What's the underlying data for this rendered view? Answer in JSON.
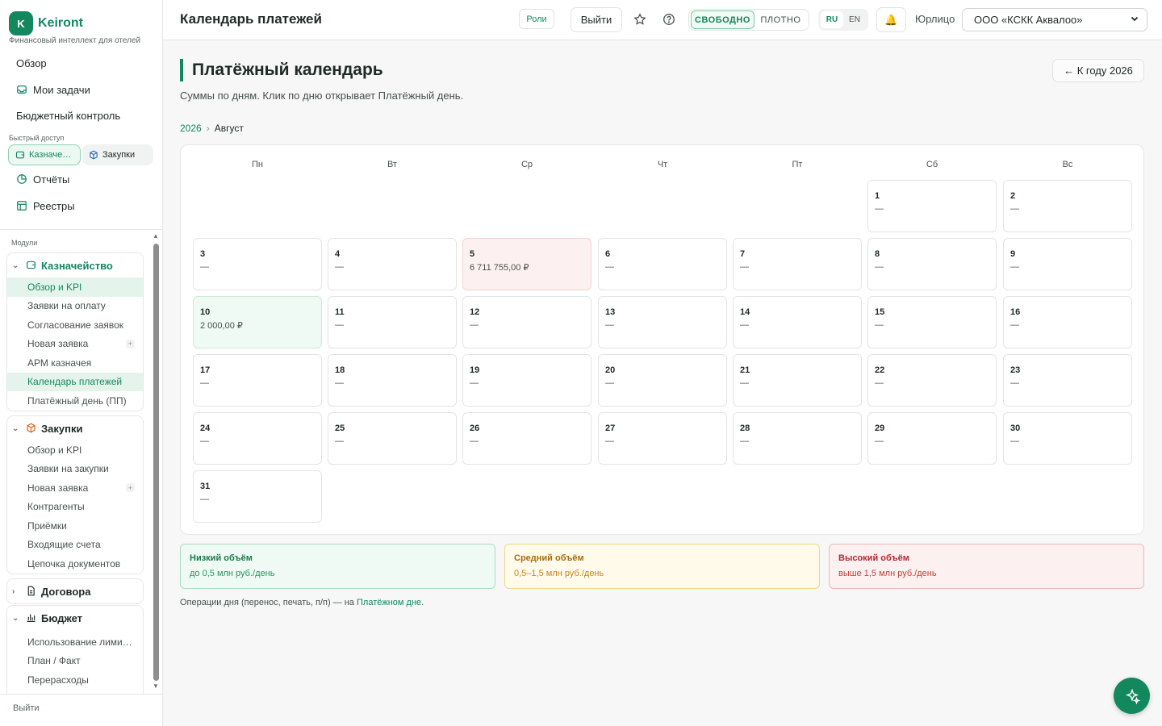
{
  "brand": {
    "logo_letter": "K",
    "name": "Keiront",
    "tagline": "Финансовый интеллект для отелей"
  },
  "sidebar": {
    "top_items": [
      {
        "label": "Обзор"
      },
      {
        "label": "Мои задачи"
      },
      {
        "label": "Бюджетный контроль"
      }
    ],
    "quick_access_label": "Быстрый доступ",
    "quick_chips": [
      {
        "label": "Казначе…"
      },
      {
        "label": "Закупки"
      }
    ],
    "extra_items": [
      {
        "label": "Отчёты"
      },
      {
        "label": "Реестры"
      }
    ],
    "modules_label": "Модули",
    "modules": [
      {
        "title": "Казначейство",
        "items": [
          "Обзор и KPI",
          "Заявки на оплату",
          "Согласование заявок",
          "Новая заявка",
          "АРМ казначея",
          "Календарь платежей",
          "Платёжный день (ПП)"
        ]
      },
      {
        "title": "Закупки",
        "items": [
          "Обзор и KPI",
          "Заявки на закупки",
          "Новая заявка",
          "Контрагенты",
          "Приёмки",
          "Входящие счета",
          "Цепочка документов"
        ]
      },
      {
        "title": "Договора",
        "items": []
      },
      {
        "title": "Бюджет",
        "items": [
          "Использование лими…",
          "План / Факт",
          "Перерасходы"
        ]
      }
    ],
    "plus_sign": "+",
    "logout_label": "Выйти"
  },
  "header": {
    "title": "Календарь платежей",
    "roles_label": "Роли",
    "exit_label": "Выйти",
    "density_options": [
      "СВОБОДНО",
      "ПЛОТНО"
    ],
    "density_selected": "СВОБОДНО",
    "languages": [
      "RU",
      "EN"
    ],
    "language_selected": "RU",
    "entity_label": "Юрлицо",
    "entity_value": "ООО «КСКК Аквалоо»"
  },
  "page": {
    "title": "Платёжный календарь",
    "subtitle": "Суммы по дням. Клик по дню открывает Платёжный день.",
    "back_label": "← К году 2026",
    "breadcrumb": {
      "year": "2026",
      "separator": "›",
      "month": "Август"
    }
  },
  "calendar": {
    "weekdays": [
      "Пн",
      "Вт",
      "Ср",
      "Чт",
      "Пт",
      "Сб",
      "Вс"
    ],
    "first_weekday_index": 5,
    "empty_mark": "—",
    "days": [
      {
        "day": "1",
        "amount": "—",
        "level": ""
      },
      {
        "day": "2",
        "amount": "—",
        "level": ""
      },
      {
        "day": "3",
        "amount": "—",
        "level": ""
      },
      {
        "day": "4",
        "amount": "—",
        "level": ""
      },
      {
        "day": "5",
        "amount": "6 711 755,00 ₽",
        "level": "high"
      },
      {
        "day": "6",
        "amount": "—",
        "level": ""
      },
      {
        "day": "7",
        "amount": "—",
        "level": ""
      },
      {
        "day": "8",
        "amount": "—",
        "level": ""
      },
      {
        "day": "9",
        "amount": "—",
        "level": ""
      },
      {
        "day": "10",
        "amount": "2 000,00 ₽",
        "level": "low"
      },
      {
        "day": "11",
        "amount": "—",
        "level": ""
      },
      {
        "day": "12",
        "amount": "—",
        "level": ""
      },
      {
        "day": "13",
        "amount": "—",
        "level": ""
      },
      {
        "day": "14",
        "amount": "—",
        "level": ""
      },
      {
        "day": "15",
        "amount": "—",
        "level": ""
      },
      {
        "day": "16",
        "amount": "—",
        "level": ""
      },
      {
        "day": "17",
        "amount": "—",
        "level": ""
      },
      {
        "day": "18",
        "amount": "—",
        "level": ""
      },
      {
        "day": "19",
        "amount": "—",
        "level": ""
      },
      {
        "day": "20",
        "amount": "—",
        "level": ""
      },
      {
        "day": "21",
        "amount": "—",
        "level": ""
      },
      {
        "day": "22",
        "amount": "—",
        "level": ""
      },
      {
        "day": "23",
        "amount": "—",
        "level": ""
      },
      {
        "day": "24",
        "amount": "—",
        "level": ""
      },
      {
        "day": "25",
        "amount": "—",
        "level": ""
      },
      {
        "day": "26",
        "amount": "—",
        "level": ""
      },
      {
        "day": "27",
        "amount": "—",
        "level": ""
      },
      {
        "day": "28",
        "amount": "—",
        "level": ""
      },
      {
        "day": "29",
        "amount": "—",
        "level": ""
      },
      {
        "day": "30",
        "amount": "—",
        "level": ""
      },
      {
        "day": "31",
        "amount": "—",
        "level": ""
      }
    ]
  },
  "legend": {
    "low": {
      "title": "Низкий объём",
      "desc": "до 0,5 млн руб./день"
    },
    "mid": {
      "title": "Средний объём",
      "desc": "0,5–1,5 млн руб./день"
    },
    "high": {
      "title": "Высокий объём",
      "desc": "выше 1,5 млн руб./день"
    }
  },
  "footnote": {
    "text": "Операции дня (перенос, печать, п/п) — на ",
    "link": "Платёжном дне",
    "suffix": "."
  },
  "colors": {
    "accent": "#13885f",
    "high_bg": "#fdf0f0",
    "low_bg": "#eefaf3",
    "mid_bg": "#fffaea"
  }
}
